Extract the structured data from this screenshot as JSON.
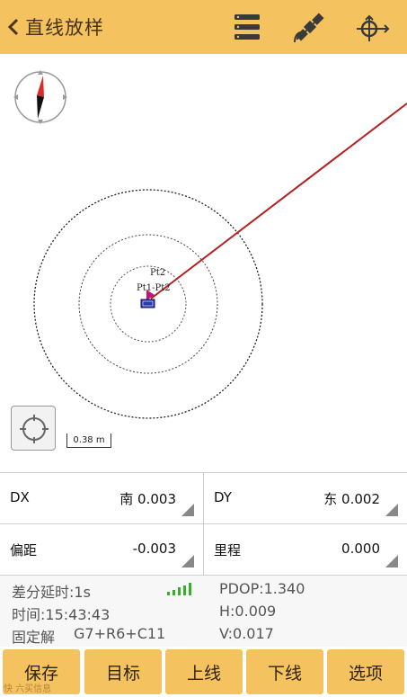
{
  "header": {
    "title": "直线放样",
    "bg_color": "#f4c35f",
    "icons": [
      "list-icon",
      "satellite-icon",
      "stakeout-point-icon"
    ]
  },
  "map": {
    "point_labels": [
      "Pt2",
      "Pt1-Pt2"
    ],
    "scale_label": "0.38 m",
    "line_color": "#b22222"
  },
  "fields": {
    "dx": {
      "label": "DX",
      "value": "南 0.003"
    },
    "dy": {
      "label": "DY",
      "value": "东 0.002"
    },
    "offset": {
      "label": "偏距",
      "value": "-0.003"
    },
    "mileage": {
      "label": "里程",
      "value": "0.000"
    }
  },
  "status": {
    "diff_delay": "差分延时:1s",
    "time": "时间:15:43:43",
    "solution_label": "固定解",
    "satellites": "G7+R6+C11",
    "pdop": "PDOP:1.340",
    "h": "H:0.009",
    "v": "V:0.017",
    "signal_color": "#3cab2e"
  },
  "buttons": {
    "save": "保存",
    "target": "目标",
    "prev_line": "上线",
    "next_line": "下线",
    "options": "选项"
  },
  "watermark": "快 六买信息"
}
